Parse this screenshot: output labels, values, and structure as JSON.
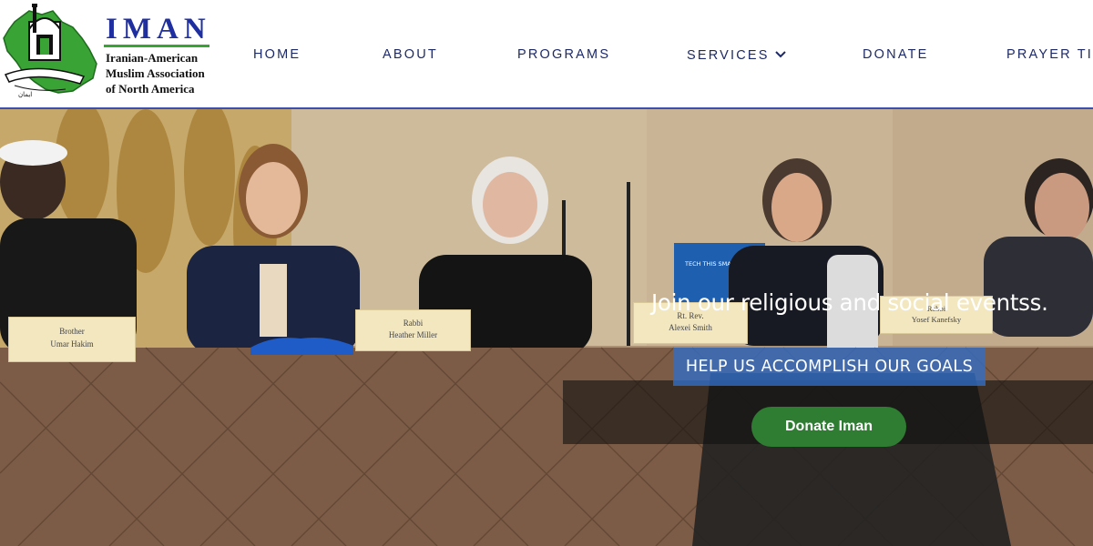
{
  "brand": {
    "name": "IMAN",
    "subtitle_lines": [
      "Iranian-American",
      "Muslim Association",
      "of North America"
    ]
  },
  "nav": {
    "items": [
      {
        "label": "HOME"
      },
      {
        "label": "ABOUT"
      },
      {
        "label": "PROGRAMS"
      },
      {
        "label": "SERVICES",
        "icon": "chevron-down-icon"
      },
      {
        "label": "DONATE"
      },
      {
        "label": "PRAYER TIMES"
      }
    ]
  },
  "hero": {
    "tagline": "Join our religious and social eventss.",
    "cta_label": "HELP US ACCOMPLISH OUR GOALS",
    "donate_label": "Donate Iman",
    "name_cards": [
      {
        "title": "Brother",
        "name": "Umar Hakim"
      },
      {
        "title": "Rabbi",
        "name": "Heather Miller"
      },
      {
        "title": "Rt. Rev.",
        "name": "Alexei Smith"
      },
      {
        "title": "Rabbi",
        "name": "Yosef Kanefsky"
      }
    ],
    "recycle_bin_text": "TECH THIS SMART IS A WISE CHOICE"
  },
  "colors": {
    "brand_blue": "#1f2fa0",
    "brand_green": "#3aa335",
    "nav_text": "#1d2a66",
    "header_rule": "#3b4fb0",
    "cta_blue": "#326ec8",
    "donate_green": "#2e7d32"
  }
}
